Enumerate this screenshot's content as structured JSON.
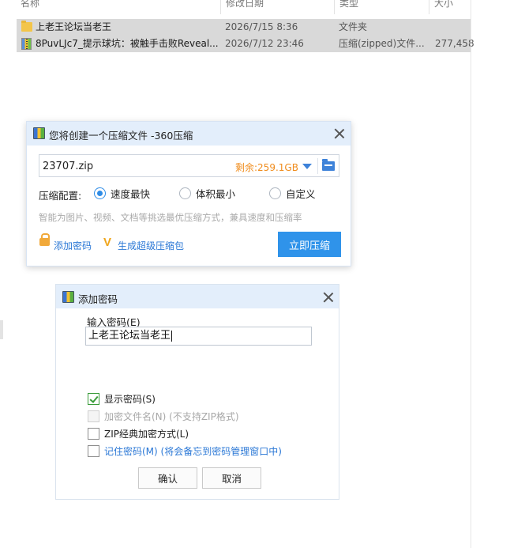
{
  "explorer": {
    "columns": [
      {
        "label": "名称"
      },
      {
        "label": "修改日期"
      },
      {
        "label": "类型"
      },
      {
        "label": "大小"
      }
    ],
    "files": [
      {
        "name": "上老王论坛当老王",
        "date": "2026/7/15 8:36",
        "type": "文件夹",
        "size": "",
        "icon": "folder-icon"
      },
      {
        "name": "8PuvLJc7_提示球坑：被触手击败Reveal...",
        "date": "2026/7/12 23:46",
        "type": "压缩(zipped)文件...",
        "size": "277,458",
        "icon": "zip-file-icon"
      }
    ]
  },
  "compress_dialog": {
    "title": "您将创建一个压缩文件 -360压缩",
    "filename": "23707.zip",
    "free_space": "剩余:259.1GB",
    "config_label": "压缩配置:",
    "options": [
      {
        "label": "速度最快",
        "selected": true
      },
      {
        "label": "体积最小",
        "selected": false
      },
      {
        "label": "自定义",
        "selected": false
      }
    ],
    "hint": "智能为图片、视频、文档等挑选最优压缩方式，兼具速度和压缩率",
    "add_password_label": "添加密码",
    "super_pack_label": "生成超级压缩包",
    "compress_button": "立即压缩",
    "accent_color": "#2f93ea"
  },
  "password_dialog": {
    "title": "添加密码",
    "input_label": "输入密码(E)",
    "password_value": "上老王论坛当老王",
    "checkboxes": [
      {
        "label": "显示密码(S)",
        "checked": true,
        "disabled": false
      },
      {
        "label": "加密文件名(N) (不支持ZIP格式)",
        "checked": false,
        "disabled": true
      },
      {
        "label": "ZIP经典加密方式(L)",
        "checked": false,
        "disabled": false
      },
      {
        "label": "记住密码(M) (将会备忘到密码管理窗口中)",
        "checked": false,
        "disabled": false
      }
    ],
    "ok_button": "确认",
    "cancel_button": "取消"
  }
}
